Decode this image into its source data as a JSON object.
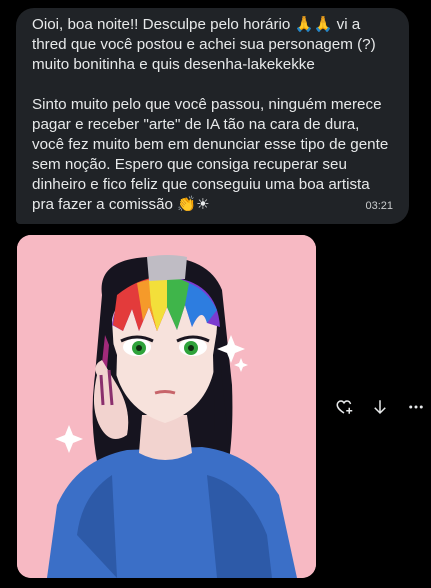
{
  "message": {
    "paragraph1": "Oioi, boa noite!! Desculpe pelo horário 🙏🙏 vi a thred que você postou e achei sua personagem (?) muito bonitinha e quis desenha-lakekekke",
    "paragraph2": "Sinto muito pelo que você passou, ninguém merece pagar e receber \"arte\" de IA tão na cara de dura, você fez muito bem em denunciar esse tipo de gente sem noção. Espero que consiga recuperar seu dinheiro e fico feliz que conseguiu uma boa artista pra fazer a comissão 👏☀",
    "time": "03:21"
  },
  "image": {
    "background_color": "#f7b9c3"
  },
  "actions": {
    "react_icon": "heart-plus-icon",
    "download_icon": "arrow-down-icon",
    "more_icon": "more-dots-icon"
  },
  "colors": {
    "bubble": "#202327",
    "text": "#e7e9ea",
    "icon": "#e7e9ea"
  }
}
